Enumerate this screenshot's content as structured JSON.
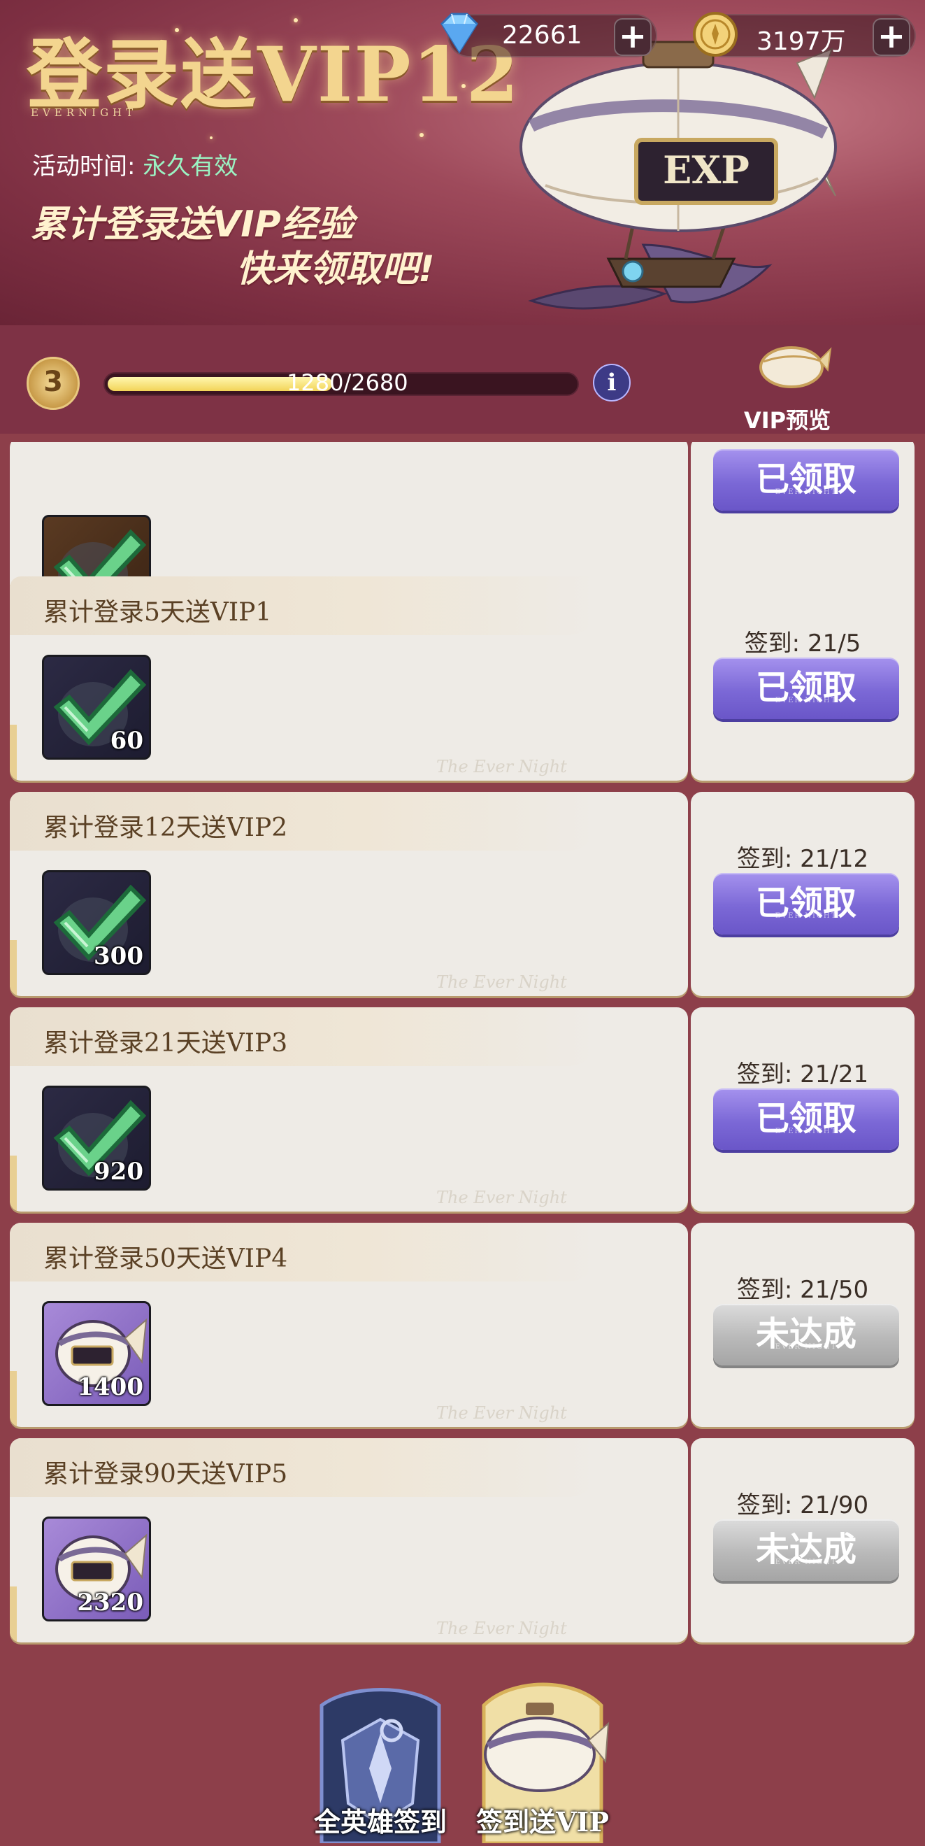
{
  "banner": {
    "title": "登录送VIP12",
    "subtitle": "EVERNIGHT",
    "activity_label": "活动时间:",
    "activity_value": "永久有效",
    "slogan_line1": "累计登录送VIP经验",
    "slogan_line2": "快来领取吧!",
    "airship_tag": "EXP"
  },
  "currency": {
    "diamonds": "22661",
    "gold": "3197万",
    "plus": "+"
  },
  "level": {
    "value": "3",
    "progress_text": "1280/2680",
    "progress_fraction": 0.478,
    "info": "i",
    "vip_preview_label": "VIP预览"
  },
  "rewards": [
    {
      "title": "",
      "reward_icon": "checkmark-crystal-icon",
      "quantity": "",
      "checkin": "",
      "button": "已领取",
      "state": "claimed"
    },
    {
      "title": "累计登录5天送VIP1",
      "reward_icon": "checkmark-crystal-icon",
      "quantity": "60",
      "checkin": "签到: 21/5",
      "button": "已领取",
      "state": "claimed"
    },
    {
      "title": "累计登录12天送VIP2",
      "reward_icon": "checkmark-crystal-icon",
      "quantity": "300",
      "checkin": "签到: 21/12",
      "button": "已领取",
      "state": "claimed"
    },
    {
      "title": "累计登录21天送VIP3",
      "reward_icon": "checkmark-crystal-icon",
      "quantity": "920",
      "checkin": "签到: 21/21",
      "button": "已领取",
      "state": "claimed"
    },
    {
      "title": "累计登录50天送VIP4",
      "reward_icon": "exp-airship-icon",
      "quantity": "1400",
      "checkin": "签到: 21/50",
      "button": "未达成",
      "state": "locked"
    },
    {
      "title": "累计登录90天送VIP5",
      "reward_icon": "exp-airship-icon",
      "quantity": "2320",
      "checkin": "签到: 21/90",
      "button": "未达成",
      "state": "locked"
    }
  ],
  "card_watermark": "The Ever Night",
  "button_small": "EVER NIGHT",
  "tabs": [
    {
      "label": "全英雄签到",
      "icon": "hero-emblem-icon"
    },
    {
      "label": "签到送VIP",
      "icon": "airship-icon",
      "active": true
    }
  ],
  "colors": {
    "background": "#8d3f4a",
    "claimed_button": "#7b68d6",
    "locked_button": "#b9b9b9",
    "progress_fill": "#f2d458",
    "activity_value": "#9bf3c3"
  }
}
